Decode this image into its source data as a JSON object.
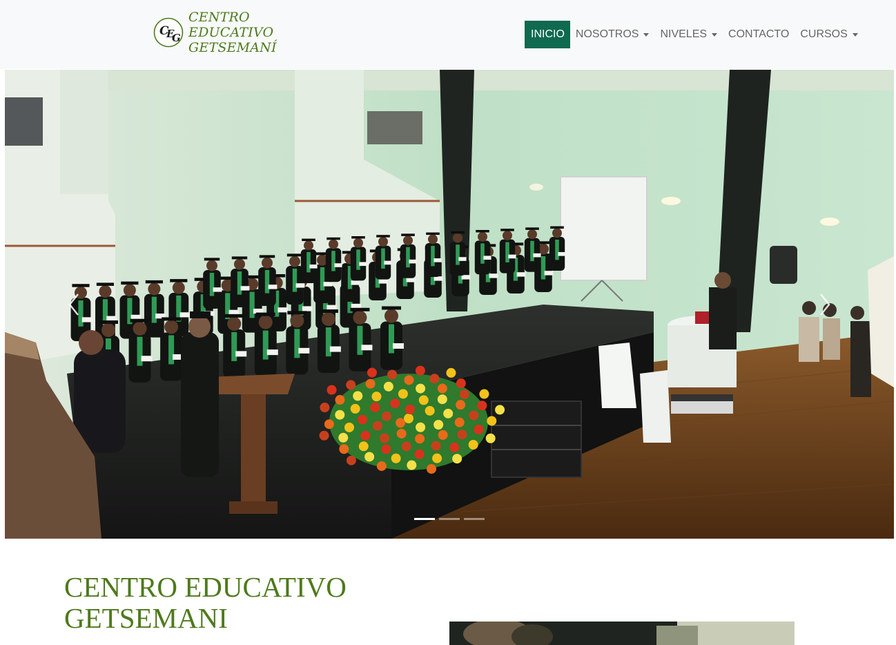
{
  "header": {
    "logo": {
      "monogram": "CEG",
      "icon": "ceg-monogram-logo"
    },
    "brand_lines": [
      "CENTRO",
      "EDUCATIVO",
      "GETSEMANÍ"
    ]
  },
  "nav": {
    "items": [
      {
        "label": "INICIO",
        "active": true,
        "dropdown": false
      },
      {
        "label": "NOSOTROS",
        "active": false,
        "dropdown": true
      },
      {
        "label": "NIVELES",
        "active": false,
        "dropdown": true
      },
      {
        "label": "CONTACTO",
        "active": false,
        "dropdown": false
      },
      {
        "label": "CURSOS",
        "active": false,
        "dropdown": true
      }
    ],
    "active_color": "#0f6a4f"
  },
  "carousel": {
    "slide_icon": "graduation-ceremony-photo",
    "prev_icon": "chevron-left-icon",
    "next_icon": "chevron-right-icon",
    "slide_count": 3,
    "active_index": 0
  },
  "intro": {
    "title_lines": [
      "CENTRO EDUCATIVO",
      "GETSEMANI"
    ],
    "title_color": "#4e7a1c"
  }
}
